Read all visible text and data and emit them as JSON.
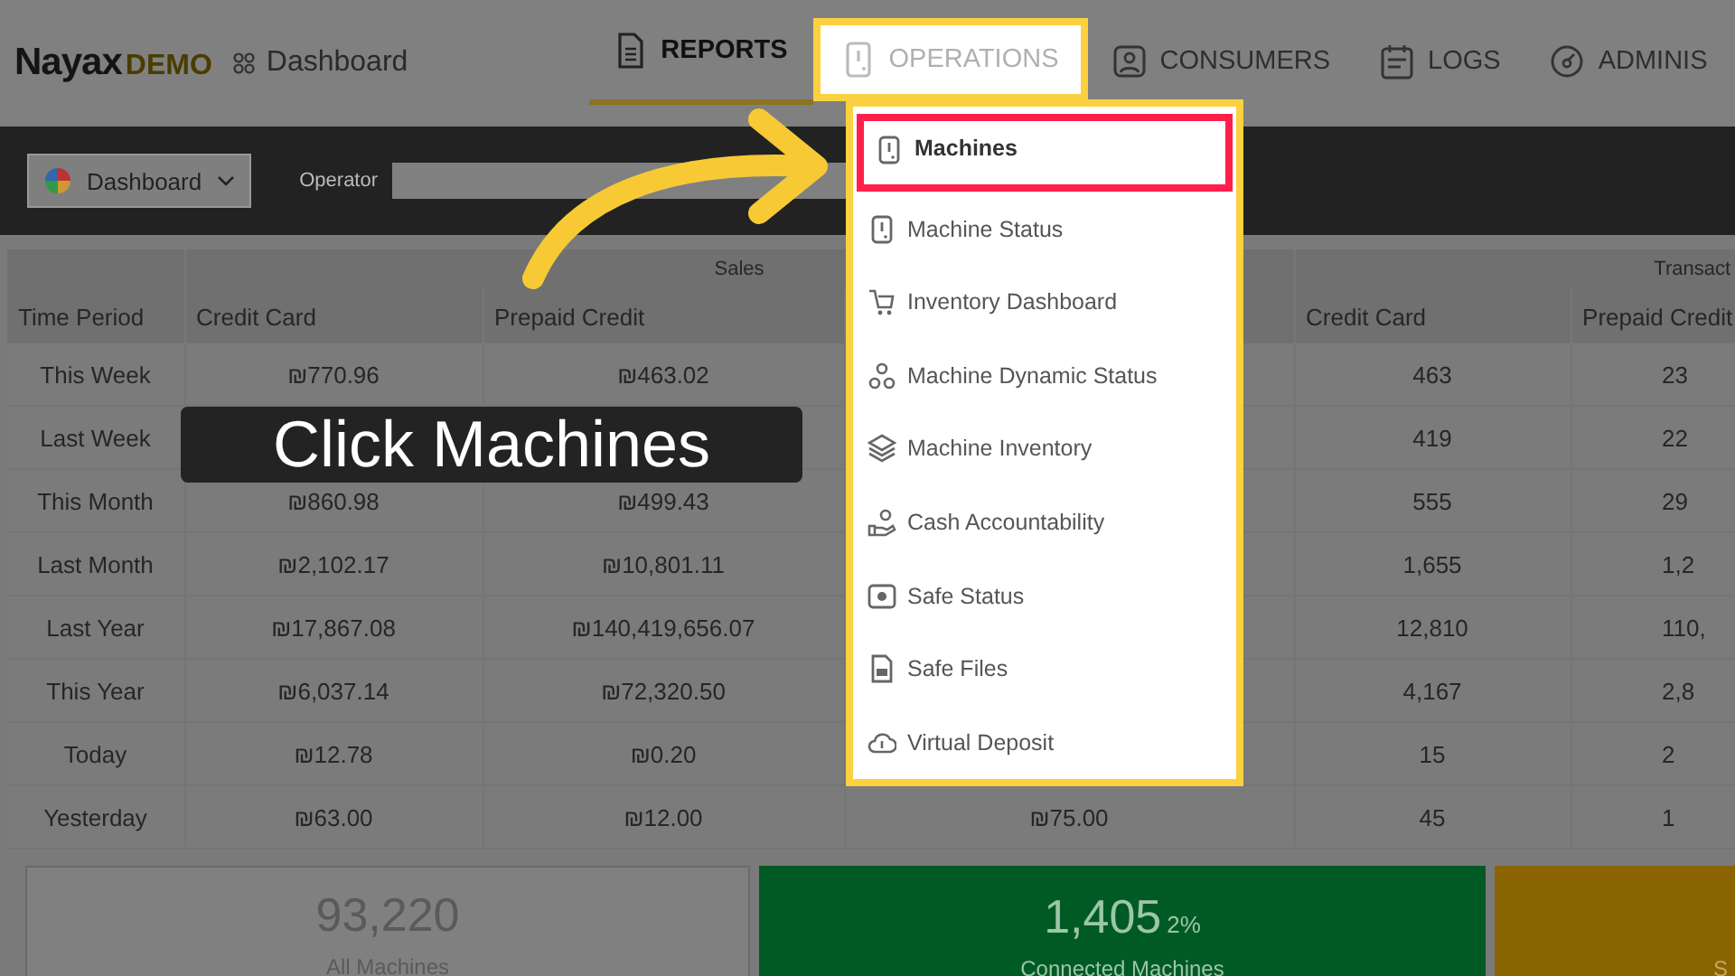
{
  "header": {
    "logo": "Nayax",
    "logo_badge": "DEMO",
    "page_title": "Dashboard"
  },
  "nav": [
    {
      "label": "REPORTS",
      "selected": true,
      "expanded": false
    },
    {
      "label": "OPERATIONS",
      "selected": false,
      "expanded": true
    },
    {
      "label": "CONSUMERS",
      "selected": false,
      "expanded": false
    },
    {
      "label": "LOGS",
      "selected": false,
      "expanded": false
    },
    {
      "label": "ADMINIS",
      "selected": false,
      "expanded": false
    }
  ],
  "operations_menu": [
    {
      "label": "Machines",
      "selected": true
    },
    {
      "label": "Machine Status",
      "selected": false
    },
    {
      "label": "Inventory Dashboard",
      "selected": false
    },
    {
      "label": "Machine Dynamic Status",
      "selected": false
    },
    {
      "label": "Machine Inventory",
      "selected": false
    },
    {
      "label": "Cash Accountability",
      "selected": false
    },
    {
      "label": "Safe Status",
      "selected": false
    },
    {
      "label": "Safe Files",
      "selected": false
    },
    {
      "label": "Virtual Deposit",
      "selected": false
    }
  ],
  "toolbar": {
    "view_select": "Dashboard",
    "operator_label": "Operator"
  },
  "table": {
    "groups": [
      "Sales",
      "Transact"
    ],
    "columns": [
      "Time Period",
      "Credit Card",
      "Prepaid Credit",
      null,
      "Credit Card",
      "Prepaid Credit"
    ],
    "rows": [
      [
        "This Week",
        "₪770.96",
        "₪463.02",
        null,
        "463",
        "23"
      ],
      [
        "Last Week",
        null,
        null,
        null,
        "419",
        "22"
      ],
      [
        "This Month",
        "₪860.98",
        "₪499.43",
        null,
        "555",
        "29"
      ],
      [
        "Last Month",
        "₪2,102.17",
        "₪10,801.11",
        null,
        "1,655",
        "1,2"
      ],
      [
        "Last Year",
        "₪17,867.08",
        "₪140,419,656.07",
        null,
        "12,810",
        "110,"
      ],
      [
        "This Year",
        "₪6,037.14",
        "₪72,320.50",
        null,
        "4,167",
        "2,8"
      ],
      [
        "Today",
        "₪12.78",
        "₪0.20",
        null,
        "15",
        "2"
      ],
      [
        "Yesterday",
        "₪63.00",
        "₪12.00",
        "₪75.00",
        "45",
        "1"
      ]
    ]
  },
  "cards": [
    {
      "kind": "neutral",
      "value": "93,220",
      "label": "All Machines",
      "color": "#808080"
    },
    {
      "kind": "status",
      "value": "1,405",
      "percent": "2%",
      "label": "Connected Machines",
      "color": "#005a24"
    },
    {
      "kind": "status",
      "label": "S",
      "color": "#8a6400"
    }
  ],
  "callout": {
    "text": "Click Machines"
  }
}
